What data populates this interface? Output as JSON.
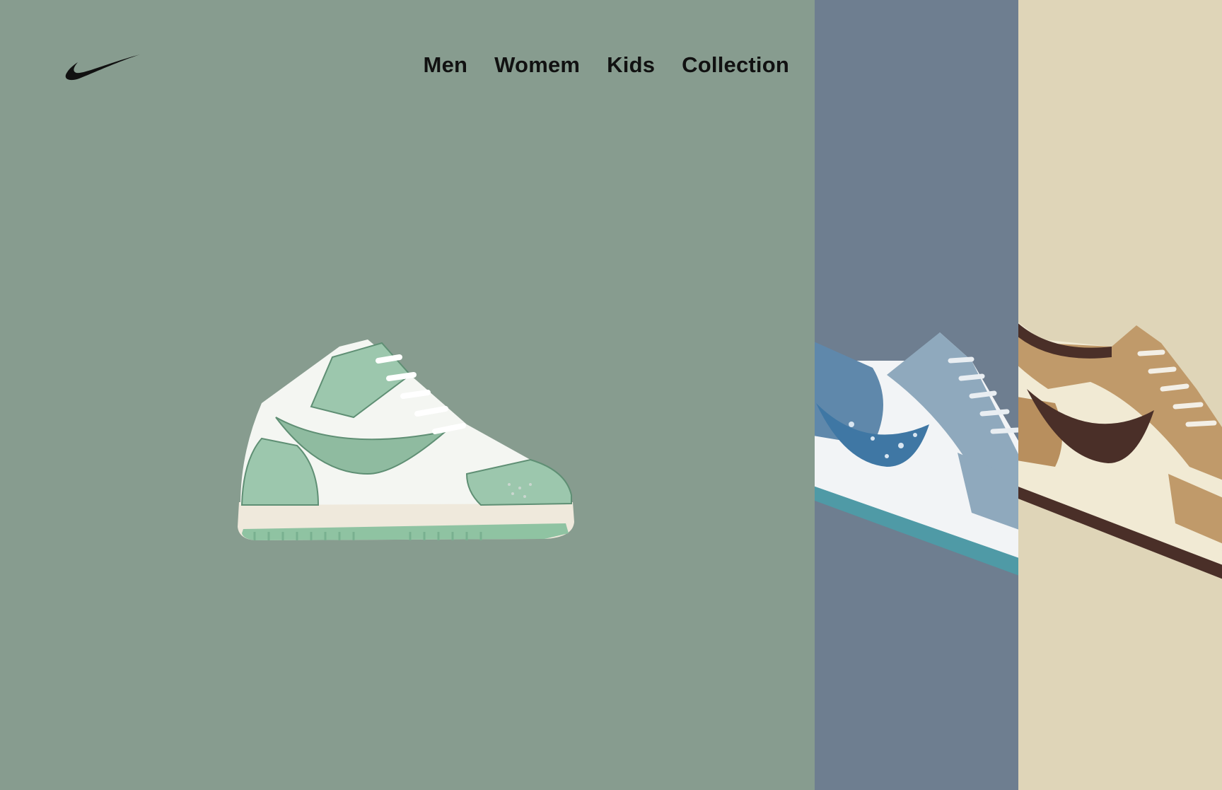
{
  "brand": {
    "logo_icon": "swoosh-logo-icon",
    "logo_color": "#111111"
  },
  "nav": {
    "items": [
      {
        "label": "Men"
      },
      {
        "label": "Womem"
      },
      {
        "label": "Kids"
      },
      {
        "label": "Collection"
      }
    ]
  },
  "panels": [
    {
      "color": "#879c8f",
      "product_icon": "high-top-sneaker-icon",
      "shoe_colors": [
        "#9cc7ad",
        "#f4f6f2",
        "#efe9dc"
      ]
    },
    {
      "color": "#6e7e90",
      "product_icon": "low-top-sneaker-icon",
      "shoe_colors": [
        "#5f88ab",
        "#f2f4f6",
        "#4f9aa6"
      ]
    },
    {
      "color": "#dfd5b8",
      "product_icon": "low-top-sneaker-icon",
      "shoe_colors": [
        "#c09a6a",
        "#f1ead4",
        "#4a2f28"
      ]
    }
  ]
}
